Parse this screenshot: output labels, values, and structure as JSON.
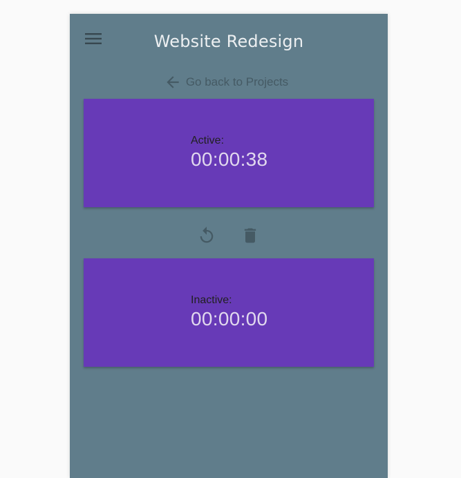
{
  "app": {
    "title": "Website Redesign"
  },
  "nav": {
    "menu_icon": "hamburger-menu-icon",
    "back_icon": "arrow-left-icon",
    "back_label": "Go back to Projects"
  },
  "timers": {
    "active": {
      "label": "Active:",
      "time": "00:00:38"
    },
    "inactive": {
      "label": "Inactive:",
      "time": "00:00:00"
    }
  },
  "actions": {
    "reset_icon": "reset-icon",
    "delete_icon": "trash-icon"
  },
  "colors": {
    "background": "#607d8b",
    "card": "#673ab7",
    "title": "#eceff1",
    "icon": "#455a64"
  }
}
